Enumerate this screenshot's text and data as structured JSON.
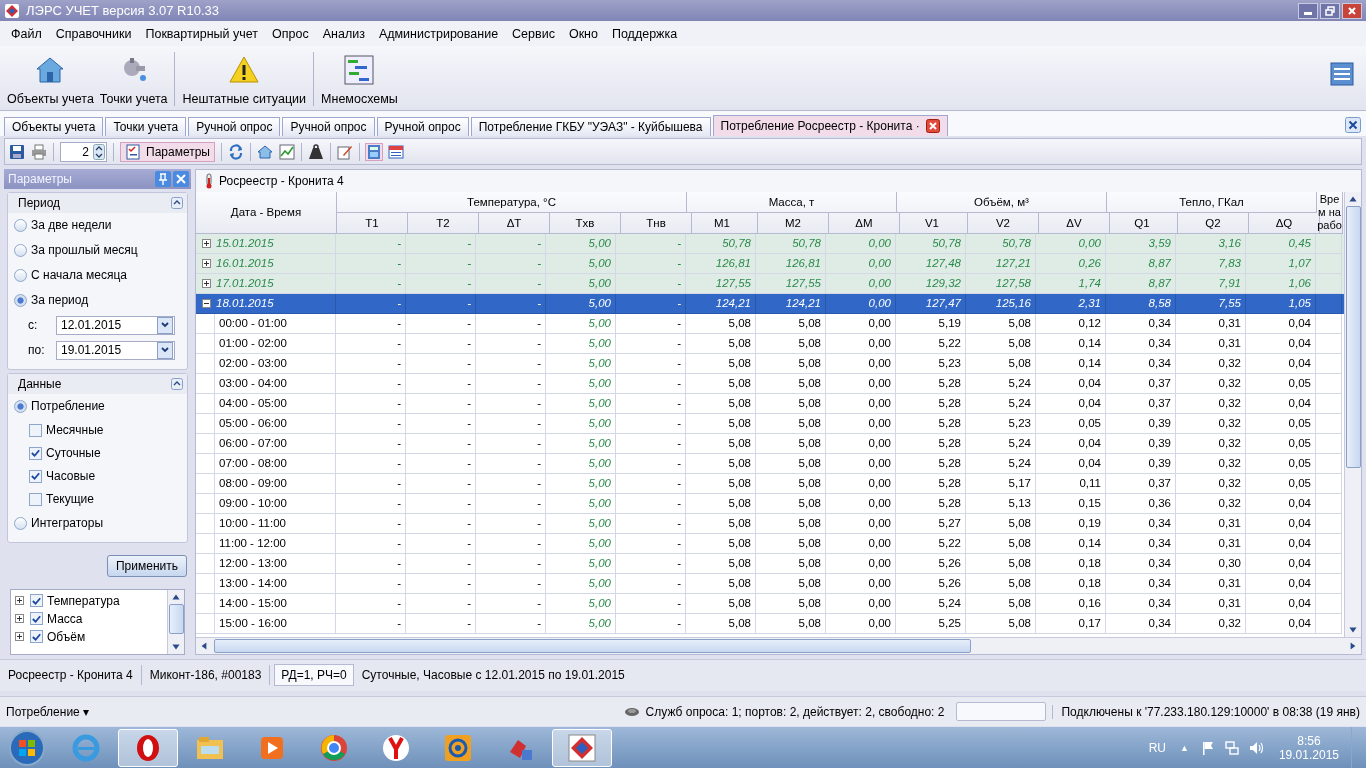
{
  "window": {
    "title": "ЛЭРС УЧЕТ версия 3.07 R10.33"
  },
  "menu": [
    "Файл",
    "Справочники",
    "Поквартирный учет",
    "Опрос",
    "Анализ",
    "Администрирование",
    "Сервис",
    "Окно",
    "Поддержка"
  ],
  "toolbar": [
    "Объекты учета",
    "Точки учета",
    "Нештатные ситуации",
    "Мнемосхемы"
  ],
  "tabs": [
    {
      "label": "Объекты учета",
      "selected": false
    },
    {
      "label": "Точки учета",
      "selected": false
    },
    {
      "label": "Ручной опрос",
      "selected": false
    },
    {
      "label": "Ручной опрос",
      "selected": false
    },
    {
      "label": "Ручной опрос",
      "selected": false
    },
    {
      "label": "Потребление ГКБУ \"УЭАЗ\" - Куйбышева",
      "selected": false
    },
    {
      "label": "Потребление Росреестр - Кронита ·",
      "selected": true
    }
  ],
  "toolbar2": {
    "page": "2",
    "params_button": "Параметры"
  },
  "params_panel": {
    "title": "Параметры",
    "period": {
      "title": "Период",
      "options": [
        {
          "label": "За две недели",
          "selected": false
        },
        {
          "label": "За прошлый месяц",
          "selected": false
        },
        {
          "label": "С начала месяца",
          "selected": false
        },
        {
          "label": "За период",
          "selected": true
        }
      ],
      "from_label": "с:",
      "from": "12.01.2015",
      "to_label": "по:",
      "to": "19.01.2015"
    },
    "data": {
      "title": "Данные",
      "options": [
        {
          "label": "Потребление",
          "selected": true,
          "children": [
            {
              "label": "Месячные",
              "checked": false
            },
            {
              "label": "Суточные",
              "checked": true
            },
            {
              "label": "Часовые",
              "checked": true
            },
            {
              "label": "Текущие",
              "checked": false
            }
          ]
        },
        {
          "label": "Интеграторы",
          "selected": false
        }
      ]
    },
    "apply_button": "Применить",
    "tree": [
      {
        "label": "Температура",
        "checked": true
      },
      {
        "label": "Масса",
        "checked": true
      },
      {
        "label": "Объём",
        "checked": true
      }
    ]
  },
  "grid": {
    "title": "Росреестр - Кронита 4",
    "date_header": "Дата - Время",
    "groups": [
      {
        "label": "Температура, °C",
        "columns": [
          "T1",
          "T2",
          "ΔT",
          "Tхв",
          "Tнв"
        ]
      },
      {
        "label": "Масса, т",
        "columns": [
          "M1",
          "M2",
          "ΔM"
        ]
      },
      {
        "label": "Объём, м³",
        "columns": [
          "V1",
          "V2",
          "ΔV"
        ]
      },
      {
        "label": "Тепло, ГКал",
        "columns": [
          "Q1",
          "Q2",
          "ΔQ"
        ]
      }
    ],
    "last_header": "Врем нарабо",
    "rows": [
      {
        "kind": "day",
        "label": "15.01.2015",
        "expanded": false,
        "selected": false,
        "cells": [
          "-",
          "-",
          "-",
          "5,00",
          "-",
          "50,78",
          "50,78",
          "0,00",
          "50,78",
          "50,78",
          "0,00",
          "3,59",
          "3,16",
          "0,45"
        ]
      },
      {
        "kind": "day",
        "label": "16.01.2015",
        "expanded": false,
        "selected": false,
        "cells": [
          "-",
          "-",
          "-",
          "5,00",
          "-",
          "126,81",
          "126,81",
          "0,00",
          "127,48",
          "127,21",
          "0,26",
          "8,87",
          "7,83",
          "1,07"
        ]
      },
      {
        "kind": "day",
        "label": "17.01.2015",
        "expanded": false,
        "selected": false,
        "cells": [
          "-",
          "-",
          "-",
          "5,00",
          "-",
          "127,55",
          "127,55",
          "0,00",
          "129,32",
          "127,58",
          "1,74",
          "8,87",
          "7,91",
          "1,06"
        ]
      },
      {
        "kind": "day",
        "label": "18.01.2015",
        "expanded": true,
        "selected": true,
        "cells": [
          "-",
          "-",
          "-",
          "5,00",
          "-",
          "124,21",
          "124,21",
          "0,00",
          "127,47",
          "125,16",
          "2,31",
          "8,58",
          "7,55",
          "1,05"
        ]
      },
      {
        "kind": "hour",
        "label": "00:00 - 01:00",
        "selected": false,
        "cells": [
          "-",
          "-",
          "-",
          "5,00",
          "-",
          "5,08",
          "5,08",
          "0,00",
          "5,19",
          "5,08",
          "0,12",
          "0,34",
          "0,31",
          "0,04"
        ]
      },
      {
        "kind": "hour",
        "label": "01:00 - 02:00",
        "selected": false,
        "cells": [
          "-",
          "-",
          "-",
          "5,00",
          "-",
          "5,08",
          "5,08",
          "0,00",
          "5,22",
          "5,08",
          "0,14",
          "0,34",
          "0,31",
          "0,04"
        ]
      },
      {
        "kind": "hour",
        "label": "02:00 - 03:00",
        "selected": false,
        "cells": [
          "-",
          "-",
          "-",
          "5,00",
          "-",
          "5,08",
          "5,08",
          "0,00",
          "5,23",
          "5,08",
          "0,14",
          "0,34",
          "0,32",
          "0,04"
        ]
      },
      {
        "kind": "hour",
        "label": "03:00 - 04:00",
        "selected": false,
        "cells": [
          "-",
          "-",
          "-",
          "5,00",
          "-",
          "5,08",
          "5,08",
          "0,00",
          "5,28",
          "5,24",
          "0,04",
          "0,37",
          "0,32",
          "0,05"
        ]
      },
      {
        "kind": "hour",
        "label": "04:00 - 05:00",
        "selected": false,
        "cells": [
          "-",
          "-",
          "-",
          "5,00",
          "-",
          "5,08",
          "5,08",
          "0,00",
          "5,28",
          "5,24",
          "0,04",
          "0,37",
          "0,32",
          "0,04"
        ]
      },
      {
        "kind": "hour",
        "label": "05:00 - 06:00",
        "selected": false,
        "cells": [
          "-",
          "-",
          "-",
          "5,00",
          "-",
          "5,08",
          "5,08",
          "0,00",
          "5,28",
          "5,23",
          "0,05",
          "0,39",
          "0,32",
          "0,05"
        ]
      },
      {
        "kind": "hour",
        "label": "06:00 - 07:00",
        "selected": false,
        "cells": [
          "-",
          "-",
          "-",
          "5,00",
          "-",
          "5,08",
          "5,08",
          "0,00",
          "5,28",
          "5,24",
          "0,04",
          "0,39",
          "0,32",
          "0,05"
        ]
      },
      {
        "kind": "hour",
        "label": "07:00 - 08:00",
        "selected": false,
        "cells": [
          "-",
          "-",
          "-",
          "5,00",
          "-",
          "5,08",
          "5,08",
          "0,00",
          "5,28",
          "5,24",
          "0,04",
          "0,39",
          "0,32",
          "0,05"
        ]
      },
      {
        "kind": "hour",
        "label": "08:00 - 09:00",
        "selected": false,
        "cells": [
          "-",
          "-",
          "-",
          "5,00",
          "-",
          "5,08",
          "5,08",
          "0,00",
          "5,28",
          "5,17",
          "0,11",
          "0,37",
          "0,32",
          "0,05"
        ]
      },
      {
        "kind": "hour",
        "label": "09:00 - 10:00",
        "selected": false,
        "cells": [
          "-",
          "-",
          "-",
          "5,00",
          "-",
          "5,08",
          "5,08",
          "0,00",
          "5,28",
          "5,13",
          "0,15",
          "0,36",
          "0,32",
          "0,04"
        ]
      },
      {
        "kind": "hour",
        "label": "10:00 - 11:00",
        "selected": false,
        "cells": [
          "-",
          "-",
          "-",
          "5,00",
          "-",
          "5,08",
          "5,08",
          "0,00",
          "5,27",
          "5,08",
          "0,19",
          "0,34",
          "0,31",
          "0,04"
        ]
      },
      {
        "kind": "hour",
        "label": "11:00 - 12:00",
        "selected": false,
        "cells": [
          "-",
          "-",
          "-",
          "5,00",
          "-",
          "5,08",
          "5,08",
          "0,00",
          "5,22",
          "5,08",
          "0,14",
          "0,34",
          "0,31",
          "0,04"
        ]
      },
      {
        "kind": "hour",
        "label": "12:00 - 13:00",
        "selected": false,
        "cells": [
          "-",
          "-",
          "-",
          "5,00",
          "-",
          "5,08",
          "5,08",
          "0,00",
          "5,26",
          "5,08",
          "0,18",
          "0,34",
          "0,30",
          "0,04"
        ]
      },
      {
        "kind": "hour",
        "label": "13:00 - 14:00",
        "selected": false,
        "cells": [
          "-",
          "-",
          "-",
          "5,00",
          "-",
          "5,08",
          "5,08",
          "0,00",
          "5,26",
          "5,08",
          "0,18",
          "0,34",
          "0,31",
          "0,04"
        ]
      },
      {
        "kind": "hour",
        "label": "14:00 - 15:00",
        "selected": false,
        "cells": [
          "-",
          "-",
          "-",
          "5,00",
          "-",
          "5,08",
          "5,08",
          "0,00",
          "5,24",
          "5,08",
          "0,16",
          "0,34",
          "0,31",
          "0,04"
        ]
      },
      {
        "kind": "hour",
        "label": "15:00 - 16:00",
        "selected": false,
        "cells": [
          "-",
          "-",
          "-",
          "5,00",
          "-",
          "5,08",
          "5,08",
          "0,00",
          "5,25",
          "5,08",
          "0,17",
          "0,34",
          "0,32",
          "0,04"
        ]
      }
    ]
  },
  "status_bar": [
    "Росреестр - Кронита 4",
    "Миконт-186, #00183",
    "РД=1, РЧ=0",
    "Суточные, Часовые с 12.01.2015 по 19.01.2015"
  ],
  "bottom_bar": {
    "mode": "Потребление ▾",
    "services": "Служб опроса: 1; портов: 2, действует: 2, свободно: 2",
    "connection": "Подключены к '77.233.180.129:10000' в 08:38 (19 янв)"
  },
  "taskbar": {
    "apps": [
      {
        "selected": false
      },
      {
        "selected": true
      },
      {
        "selected": false
      },
      {
        "selected": false
      },
      {
        "selected": false
      },
      {
        "selected": false
      },
      {
        "selected": false
      },
      {
        "selected": false
      },
      {
        "selected": true
      }
    ],
    "lang": "RU",
    "tray_arrow": "▲",
    "time": "8:56",
    "date": "19.01.2015"
  }
}
